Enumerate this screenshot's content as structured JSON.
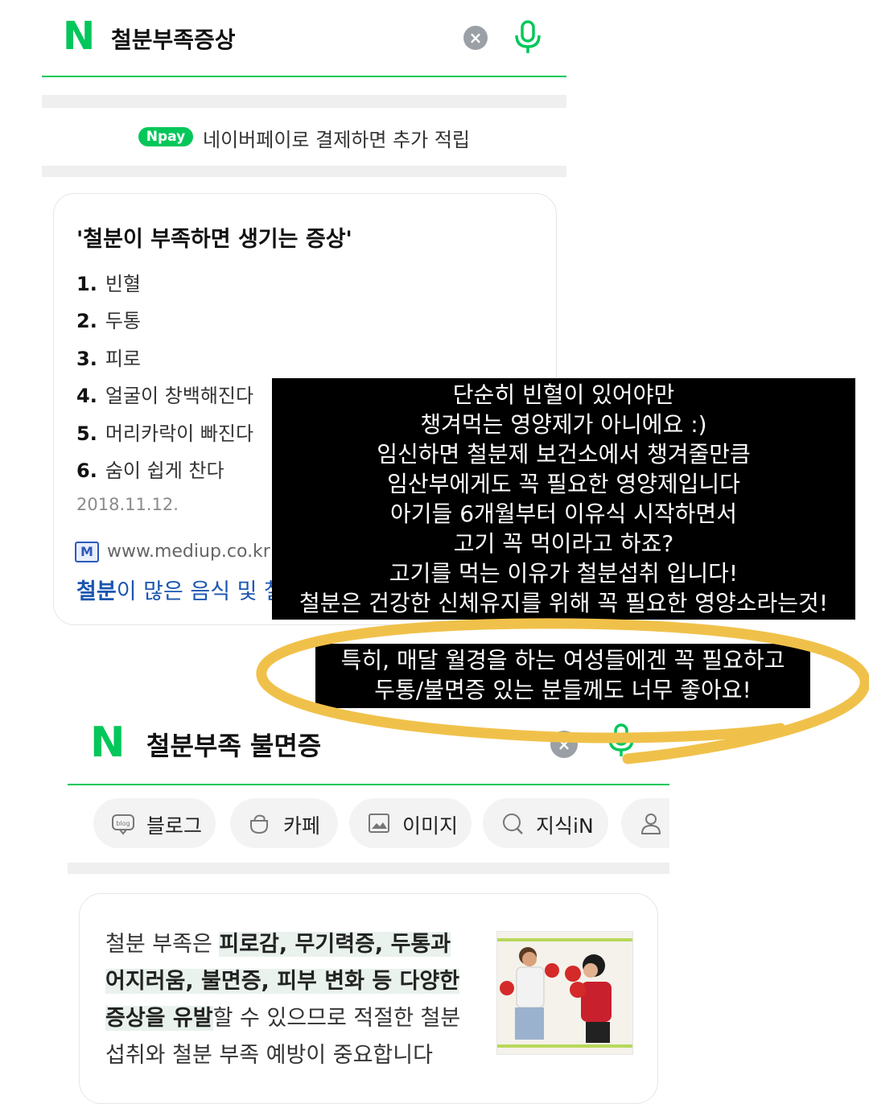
{
  "search_top": {
    "logo": "N",
    "query": "철분부족증상"
  },
  "npay_banner": {
    "badge": "Npay",
    "text": "네이버페이로 결제하면 추가 적립"
  },
  "answer_card": {
    "title": "'철분이 부족하면 생기는 증상'",
    "items": [
      {
        "num": "1.",
        "text": "빈혈"
      },
      {
        "num": "2.",
        "text": "두통"
      },
      {
        "num": "3.",
        "text": "피로"
      },
      {
        "num": "4.",
        "text": "얼굴이 창백해진다"
      },
      {
        "num": "5.",
        "text": "머리카락이 빠진다"
      },
      {
        "num": "6.",
        "text": "숨이 쉽게 찬다"
      }
    ],
    "date": "2018.11.12.",
    "site_icon": "M",
    "site": "www.mediup.co.kr",
    "link_bold": "철분",
    "link_rest": "이 많은 음식 및 철"
  },
  "overlay_note": {
    "lines": [
      "단순히 빈혈이 있어야만",
      "챙겨먹는 영양제가 아니에요 :)",
      "임신하면 철분제 보건소에서 챙겨줄만큼",
      "임산부에게도 꼭 필요한 영양제입니다",
      "아기들 6개월부터 이유식 시작하면서",
      "고기 꼭 먹이라고 하죠?",
      "고기를 먹는 이유가 철분섭취 입니다!",
      "철분은 건강한 신체유지를 위해 꼭 필요한 영양소라는것!"
    ]
  },
  "overlay_highlight": {
    "lines": [
      "특히, 매달 월경을 하는 여성들에겐 꼭 필요하고",
      "두통/불면증 있는 분들께도 너무 좋아요!"
    ],
    "ring_color": "#f0c14a"
  },
  "search_bottom": {
    "logo": "N",
    "query": "철분부족 불면증"
  },
  "tabs": [
    {
      "icon": "blog-icon",
      "label": "블로그"
    },
    {
      "icon": "cafe-icon",
      "label": "카페"
    },
    {
      "icon": "image-icon",
      "label": "이미지"
    },
    {
      "icon": "kin-icon",
      "label": "지식iN"
    },
    {
      "icon": "person-icon",
      "label": ""
    }
  ],
  "result_card": {
    "text_1": "철분 부족은 ",
    "hl_1": "피로감, 무기력증, 두통과",
    "hl_2": "어지러움, 불면증, 피부 변화 등 다양한",
    "hl_3": "증상을 유발",
    "text_2": "할 수 있으므로 적절한 철분",
    "text_3": "섭취와 철분 부족 예방이 중요합니다"
  },
  "colors": {
    "naver_green": "#03c75a",
    "link_blue": "#1b56b0",
    "highlight_bg": "#e9f2ec",
    "overlay_bg": "#000000"
  }
}
